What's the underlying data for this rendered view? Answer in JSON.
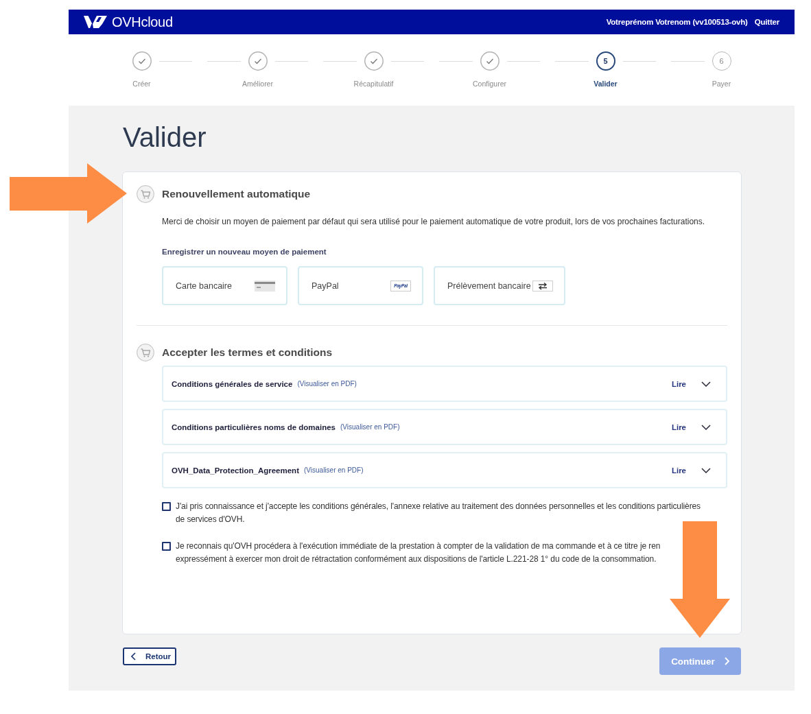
{
  "header": {
    "brand": "OVHcloud",
    "user": "Votreprénom Votrenom (vv100513-ovh)",
    "logout": "Quitter"
  },
  "steps": [
    {
      "label": "Créer",
      "completed": true,
      "selected": false
    },
    {
      "label": "Améliorer",
      "completed": true,
      "selected": false
    },
    {
      "label": "Récapitulatif",
      "completed": true,
      "selected": false
    },
    {
      "label": "Configurer",
      "completed": true,
      "selected": false
    },
    {
      "label": "Valider",
      "completed": false,
      "selected": true,
      "number": "5"
    },
    {
      "label": "Payer",
      "completed": false,
      "selected": false,
      "number": "6"
    }
  ],
  "page_title": "Valider",
  "renewal": {
    "title": "Renouvellement automatique",
    "description": "Merci de choisir un moyen de paiement par défaut qui sera utilisé pour le paiement automatique de votre produit, lors de vos prochaines facturations.",
    "subtitle": "Enregistrer un nouveau moyen de paiement",
    "methods": [
      {
        "label": "Carte bancaire",
        "kind": "card"
      },
      {
        "label": "PayPal",
        "kind": "paypal",
        "logo_text": "PayPal"
      },
      {
        "label": "Prélèvement bancaire",
        "kind": "transfer"
      }
    ]
  },
  "terms": {
    "title": "Accepter les termes et conditions",
    "documents": [
      {
        "title": "Conditions générales de service",
        "link": "(Visualiser en PDF)",
        "action": "Lire",
        "expanded": false
      },
      {
        "title": "Conditions particulières noms de domaines",
        "link": "(Visualiser en PDF)",
        "action": "Lire",
        "expanded": false
      },
      {
        "title": "OVH_Data_Protection_Agreement",
        "link": "(Visualiser en PDF)",
        "action": "Lire",
        "expanded": false
      }
    ],
    "agreements": [
      {
        "lines": [
          "J'ai pris connaissance et j'accepte les conditions générales, l'annexe relative au traitement des données personnelles et les conditions particulières",
          "de services d'OVH."
        ],
        "checked": false
      },
      {
        "lines": [
          "Je reconnais qu'OVH procédera à l'exécution immédiate de la prestation à compter de la validation de ma commande et à ce titre je ren",
          "expressément à exercer mon droit de rétractation conformément aux dispositions de l'article L.221-28 1° du code de la consommation."
        ],
        "checked": false
      }
    ]
  },
  "buttons": {
    "back": "Retour",
    "next": {
      "label": "Continuer",
      "disabled": true
    }
  },
  "annotations": [
    {
      "kind": "rightarrow"
    },
    {
      "kind": "downarrow"
    }
  ]
}
